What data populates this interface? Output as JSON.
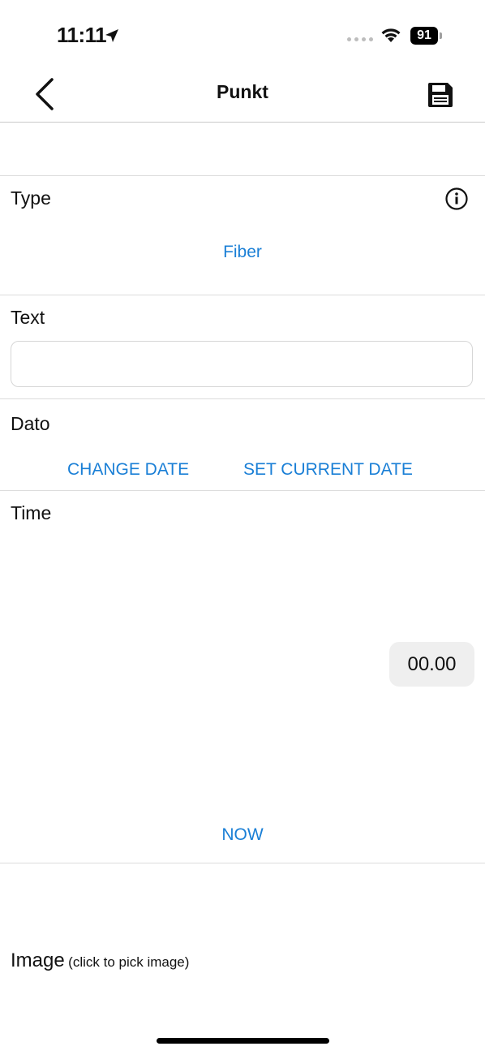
{
  "status_bar": {
    "time": "11:11",
    "battery": "91"
  },
  "nav": {
    "title": "Punkt",
    "back_icon": "chevron-left-icon",
    "save_icon": "floppy-disk-icon"
  },
  "type_section": {
    "label": "Type",
    "value": "Fiber",
    "info_icon": "info-icon"
  },
  "text_section": {
    "label": "Text",
    "value": "",
    "placeholder": ""
  },
  "date_section": {
    "label": "Dato",
    "change_date": "CHANGE DATE",
    "set_current_date": "SET CURRENT DATE"
  },
  "time_section": {
    "label": "Time",
    "value": "00.00",
    "now": "NOW"
  },
  "image_section": {
    "label": "Image",
    "hint": "(click to pick image)"
  },
  "colors": {
    "accent": "#1a7fd6"
  }
}
